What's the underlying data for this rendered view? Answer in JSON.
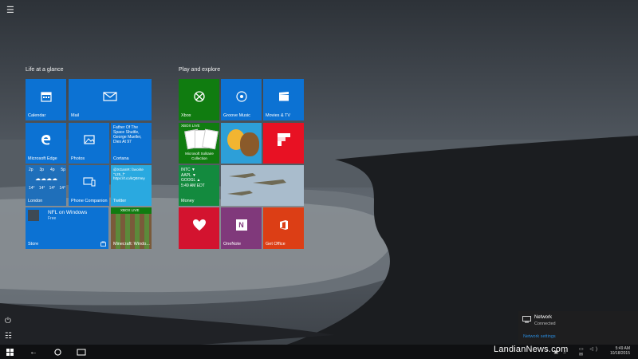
{
  "start": {
    "group1_title": "Life at a glance",
    "group2_title": "Play and explore",
    "tiles": {
      "calendar": "Calendar",
      "mail": "Mail",
      "edge": "Microsoft Edge",
      "photos": "Photos",
      "cortana_text": "Father Of The Space Shuttle, George Mueller, Dies At 97",
      "cortana": "Cortana",
      "weather_days": [
        "2p",
        "3p",
        "4p",
        "5p"
      ],
      "weather_temps": [
        "14°",
        "14°",
        "14°",
        "14°"
      ],
      "weather_city": "London",
      "phone": "Phone Companion",
      "twitter_text": "@XGamR: favorite \"L25_f\" https://t.co/kQBrVey",
      "twitter": "Twitter",
      "store_title": "NFL on Windows",
      "store_sub": "Free",
      "store": "Store",
      "minecraft_badge": "XBOX LIVE",
      "minecraft": "Minecraft: Windo...",
      "xbox": "Xbox",
      "groove": "Groove Music",
      "movies": "Movies & TV",
      "solitaire_badge": "XBOX LIVE",
      "solitaire": "Microsoft Solitaire Collection",
      "money_rows": [
        "INTC ▼",
        "AAPL ▼",
        "GOOGL ▲",
        "5:49 AM EDT"
      ],
      "money": "Money",
      "onenote": "OneNote",
      "office": "Get Office"
    }
  },
  "flyout": {
    "title": "Network",
    "status": "Connected",
    "settings": "Network settings"
  },
  "watermark": "LandianNews.com",
  "tray": {
    "time": "5:49 AM",
    "date": "10/18/2015"
  }
}
